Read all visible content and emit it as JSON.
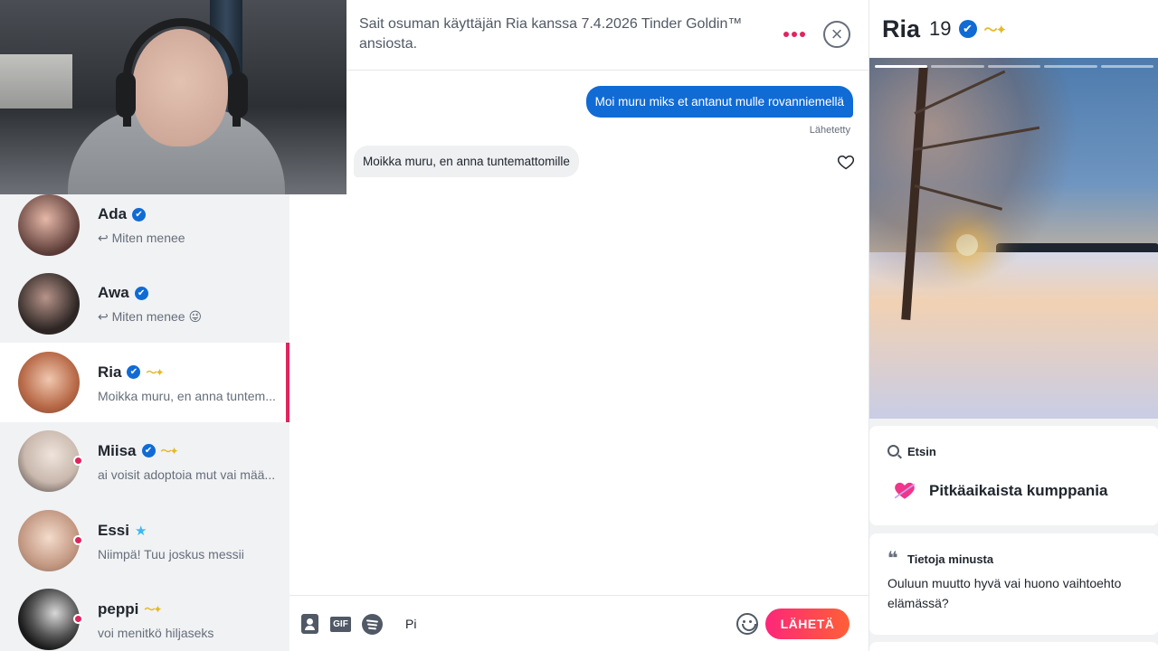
{
  "chat": {
    "match_text": "Sait osuman käyttäjän Ria kanssa 7.4.2026 Tinder Goldin™ ansiosta.",
    "messages": {
      "outgoing": "Moi muru miks et antanut mulle rovanniemellä",
      "sent_label": "Lähetetty",
      "incoming": "Moikka muru, en anna tuntemattomille"
    },
    "composer": {
      "gif_label": "GIF",
      "input_value": "Pi",
      "send_label": "LÄHETÄ"
    }
  },
  "conversations": [
    {
      "name": "Ada",
      "badge": "verified",
      "preview": "↩ Miten menee",
      "online": false,
      "gold": false,
      "avatar_color": "#5a3a36"
    },
    {
      "name": "Awa",
      "badge": "verified",
      "preview": "↩ Miten menee 😜",
      "online": false,
      "gold": false,
      "avatar_color": "#2d2624"
    },
    {
      "name": "Ria",
      "badge": "verified",
      "preview": "Moikka muru, en anna tuntem...",
      "online": false,
      "gold": true,
      "active": true,
      "avatar_color": "#b86a48"
    },
    {
      "name": "Miisa",
      "badge": "verified",
      "preview": "ai voisit adoptoia mut vai mää...",
      "online": true,
      "gold": true,
      "avatar_color": "#c9b8ad"
    },
    {
      "name": "Essi",
      "badge": "star",
      "preview": "Niimpä! Tuu joskus messii",
      "online": true,
      "gold": false,
      "avatar_color": "#c49a84"
    },
    {
      "name": "peppi",
      "badge": "none",
      "preview": "voi menitkö hiljaseks",
      "online": true,
      "gold": true,
      "avatar_color": "#1a1a1a"
    }
  ],
  "profile": {
    "name": "Ria",
    "age": "19",
    "looking_label": "Etsin",
    "looking_value": "Pitkäaikaista kumppania",
    "about_label": "Tietoja minusta",
    "about_text": "Ouluun muutto hyvä vai huono vaihtoehto elämässä?",
    "photo_count": 5,
    "photo_active": 1
  },
  "icons": {
    "verified": "✔",
    "star": "★",
    "gold": "〜✦",
    "close": "×",
    "quote": "❝"
  },
  "colors": {
    "brand_pink": "#e0245e",
    "send_gradient_start": "#fd267a",
    "send_gradient_end": "#ff6036",
    "message_blue": "#106bd5"
  }
}
